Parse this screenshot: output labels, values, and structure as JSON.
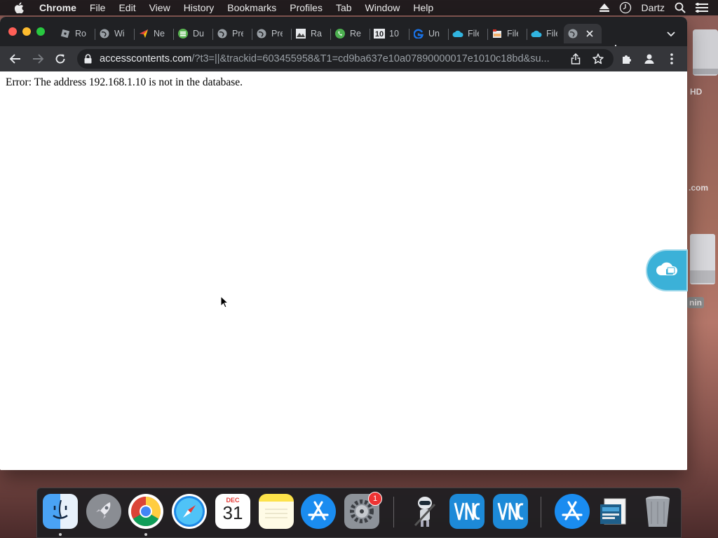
{
  "menubar": {
    "app_name": "Chrome",
    "items": [
      "File",
      "Edit",
      "View",
      "History",
      "Bookmarks",
      "Profiles",
      "Tab",
      "Window",
      "Help"
    ],
    "user": "Dartz"
  },
  "desktop": {
    "labels": [
      "HD",
      ".com",
      "nin"
    ]
  },
  "tabs": [
    {
      "title": "Rol",
      "icon": "roblox-icon"
    },
    {
      "title": "Wi",
      "icon": "globe-icon"
    },
    {
      "title": "Ne",
      "icon": "send-icon"
    },
    {
      "title": "Du",
      "icon": "green-db-icon"
    },
    {
      "title": "Pre",
      "icon": "globe-icon"
    },
    {
      "title": "Pre",
      "icon": "globe-icon"
    },
    {
      "title": "Ra",
      "icon": "image-icon"
    },
    {
      "title": "Re",
      "icon": "phone-icon"
    },
    {
      "title": "10",
      "icon": "ten-icon"
    },
    {
      "title": "Un",
      "icon": "g-icon"
    },
    {
      "title": "File",
      "icon": "cloud-icon"
    },
    {
      "title": "File",
      "icon": "folder-icon"
    },
    {
      "title": "File",
      "icon": "cloud-icon"
    },
    {
      "title": "",
      "icon": "globe-icon",
      "active": true
    }
  ],
  "address_bar": {
    "host": "accesscontents.com",
    "path": "/?t3=||&trackid=603455958&T1=cd9ba637e10a07890000017e1010c18bd&su..."
  },
  "page": {
    "error_message": "Error: The address 192.168.1.10 is not in the database."
  },
  "dock": {
    "items": [
      "Finder",
      "Launchpad",
      "Google Chrome",
      "Safari",
      "Calendar",
      "Notes",
      "App Store",
      "System Preferences",
      "Automator",
      "VNC Viewer",
      "VNC Viewer",
      "App Store",
      "Preview",
      "Trash"
    ],
    "calendar": {
      "month": "DEC",
      "day": "31"
    },
    "sysprefs_badge": "1"
  },
  "colors": {
    "tabstrip_bg": "#202124",
    "toolbar_bg": "#35363a",
    "accent_cloud": "#3bb1d8"
  }
}
